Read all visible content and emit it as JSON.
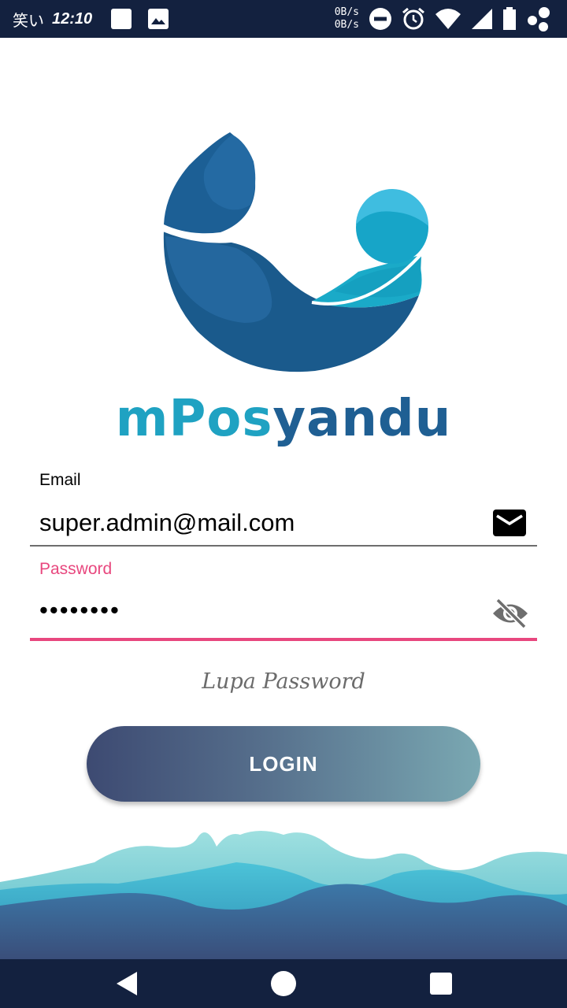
{
  "status_bar": {
    "carrier": "笑い",
    "time": "12:10",
    "net_up": "0B/s",
    "net_down": "0B/s",
    "icons": [
      "notification-square-icon",
      "image-icon",
      "do-not-disturb-icon",
      "alarm-icon",
      "wifi-icon",
      "signal-icon",
      "battery-icon",
      "app-bubble-icon"
    ]
  },
  "brand": {
    "name_part1": "mPos",
    "name_part2": "yandu",
    "colors": {
      "dark_blue": "#1f5f93",
      "light_blue": "#1fa2c2"
    }
  },
  "form": {
    "email": {
      "label": "Email",
      "value": "super.admin@mail.com",
      "icon": "email-icon"
    },
    "password": {
      "label": "Password",
      "value": "••••••••",
      "icon": "visibility-off-icon",
      "accent": "#e8477e"
    },
    "forgot_password": "Lupa Password",
    "login_button": "LOGIN"
  },
  "nav_bar": {
    "icons": [
      "back-icon",
      "home-icon",
      "recents-icon"
    ]
  }
}
